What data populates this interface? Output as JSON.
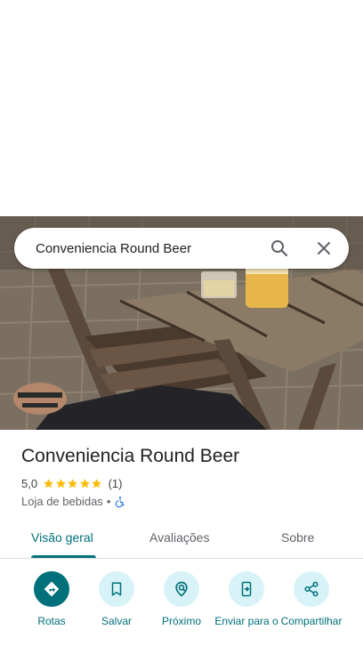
{
  "search": {
    "query": "Conveniencia Round Beer"
  },
  "place": {
    "title": "Conveniencia Round Beer",
    "rating": "5,0",
    "review_count": "(1)",
    "stars": 5,
    "category": "Loja de bebidas",
    "separator": "•"
  },
  "tabs": [
    {
      "label": "Visão geral"
    },
    {
      "label": "Avaliações"
    },
    {
      "label": "Sobre"
    }
  ],
  "actions": [
    {
      "label": "Rotas"
    },
    {
      "label": "Salvar"
    },
    {
      "label": "Próximo"
    },
    {
      "label": "Enviar para o"
    },
    {
      "label": "Compartilhar"
    }
  ],
  "colors": {
    "accent": "#00707a",
    "action_bg": "#d8f3f7",
    "star": "#fbbc04"
  }
}
